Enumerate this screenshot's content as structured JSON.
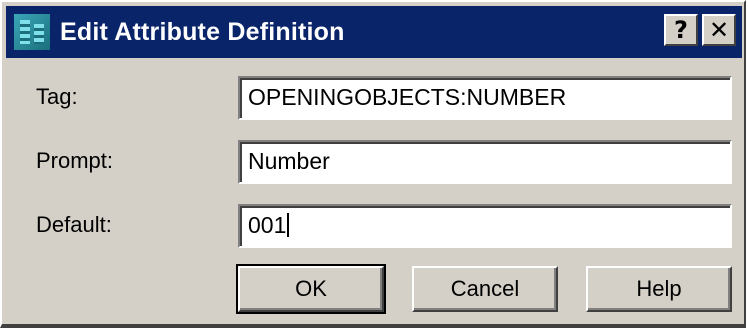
{
  "window": {
    "title": "Edit Attribute Definition",
    "help_button": "?",
    "close_button": "✕"
  },
  "fields": {
    "tag": {
      "label": "Tag:",
      "value": "OPENINGOBJECTS:NUMBER"
    },
    "prompt": {
      "label": "Prompt:",
      "value": "Number"
    },
    "default": {
      "label": "Default:",
      "value": "001"
    }
  },
  "buttons": {
    "ok": "OK",
    "cancel": "Cancel",
    "help": "Help"
  },
  "colors": {
    "titlebar": "#0a246a",
    "face": "#d4d0c8"
  }
}
